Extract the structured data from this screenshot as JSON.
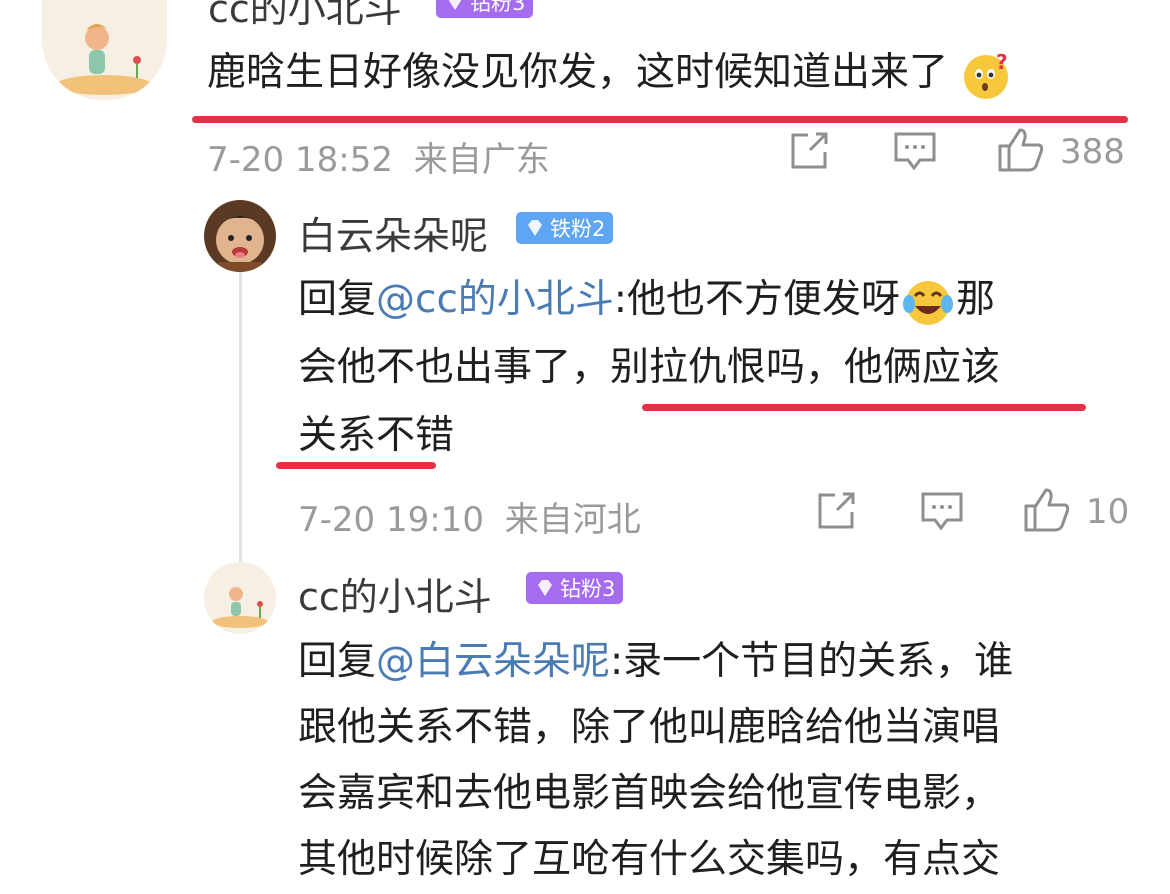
{
  "top_comment": {
    "username": "cc的小北斗",
    "badge": "钻粉3",
    "text": "鹿晗生日好像没见你发，这时候知道出来了",
    "time": "7-20 18:52",
    "location": "来自广东",
    "likes": "388"
  },
  "reply1": {
    "username": "白云朵朵呢",
    "badge": "铁粉2",
    "prefix": "回复",
    "mention": "@cc的小北斗",
    "line1_text": ":他也不方便发呀",
    "line1_tail": "那",
    "line2": "会他不也出事了，别拉仇恨吗，他俩应该",
    "line3": "关系不错",
    "time": "7-20 19:10",
    "location": "来自河北",
    "likes": "10"
  },
  "reply2": {
    "username": "cc的小北斗",
    "badge": "钻粉3",
    "prefix": "回复",
    "mention": "@白云朵朵呢",
    "line1_text": ":录一个节目的关系，谁",
    "line2": "跟他关系不错，除了他叫鹿晗给他当演唱",
    "line3": "会嘉宾和去他电影首映会给他宣传电影，",
    "line4": "其他时候除了互呛有什么交集吗，有点交"
  },
  "colors": {
    "badge_diamond": "#a56cf0",
    "badge_iron": "#5ea5f4",
    "mention": "#4a7bb3",
    "underline": "#e23246"
  }
}
